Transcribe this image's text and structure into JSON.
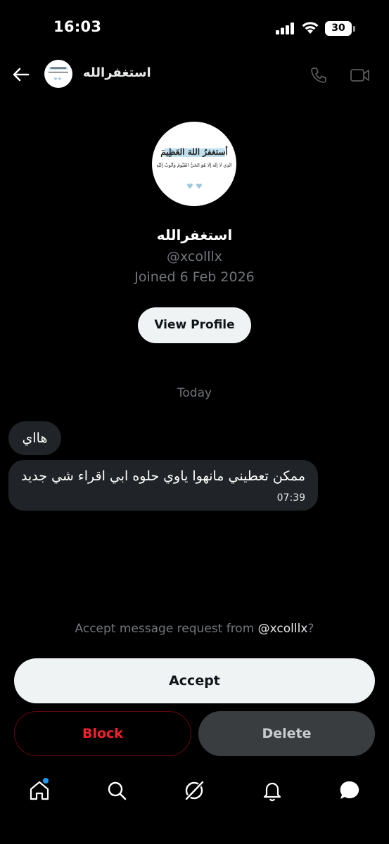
{
  "status_bar": {
    "time": "16:03",
    "battery": "30"
  },
  "header": {
    "title": "استغفرالله"
  },
  "profile": {
    "name": "استغفرالله",
    "handle": "@xcolllx",
    "joined": "Joined 6 Feb 2026",
    "view_profile_label": "View Profile",
    "avatar_line1": "أستغفرُ اللهَ العَظِيمَ",
    "avatar_line2": "الَّذِي لَا إِلَهَ إِلَّا هُوَ الحَيُّ القَيُّومُ وَأَتُوبُ إِلَيْهِ"
  },
  "conversation": {
    "day_label": "Today",
    "messages": [
      {
        "text": "هااي"
      },
      {
        "text": "ممكن تعطيني مانهوا ياوي حلوه ابي اقراء شي جديد",
        "time": "07:39"
      }
    ]
  },
  "request": {
    "prefix": "Accept message request from ",
    "handle": "@xcolllx",
    "suffix": "?",
    "accept_label": "Accept",
    "block_label": "Block",
    "delete_label": "Delete"
  },
  "colors": {
    "accent": "#1d9bf0",
    "danger": "#f4212e",
    "muted": "#71767b",
    "bubble": "#202327"
  },
  "nav": {
    "icons": [
      "home-icon",
      "search-icon",
      "grok-icon",
      "notifications-icon",
      "messages-icon"
    ]
  }
}
